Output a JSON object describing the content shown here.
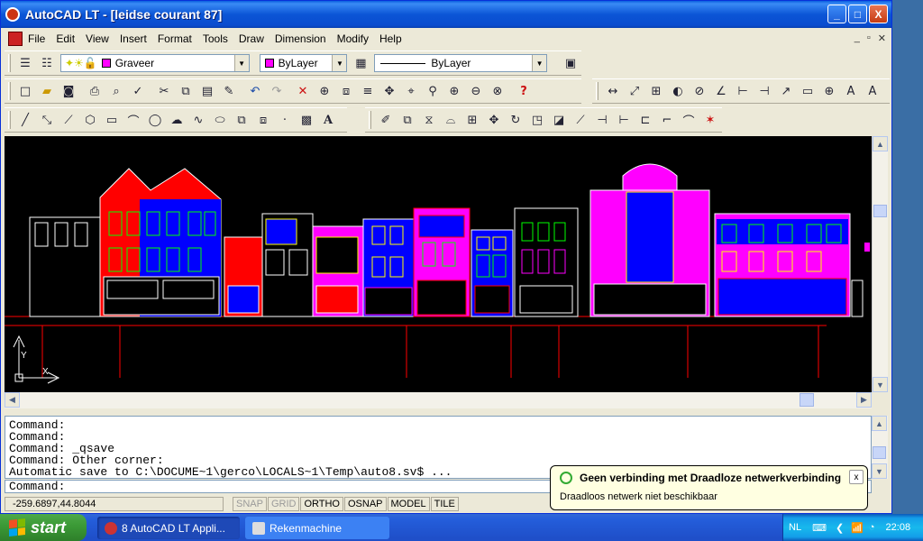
{
  "window": {
    "title": "AutoCAD LT - [leidse courant 87]",
    "minimize": "_",
    "maximize": "□",
    "close": "X"
  },
  "menu": {
    "items": [
      "File",
      "Edit",
      "View",
      "Insert",
      "Format",
      "Tools",
      "Draw",
      "Dimension",
      "Modify",
      "Help"
    ],
    "doc_controls": [
      "_",
      "▫",
      "✕"
    ]
  },
  "layer_toolbar": {
    "layer_name": "Graveer",
    "color_value": "ByLayer",
    "linetype_value": "ByLayer",
    "layer_color": "#ff00ff"
  },
  "drawing": {
    "background": "#000000",
    "accent_red": "#ff0000",
    "accent_magenta": "#ff00ff",
    "accent_blue": "#0000ff",
    "accent_yellow": "#ffff00",
    "accent_green": "#00ff00",
    "ucs_y_label": "Y",
    "ucs_x_label": "X"
  },
  "command": {
    "history": [
      "Command:",
      "Command:",
      "Command: _qsave",
      "Command: Other corner:",
      "Automatic save to C:\\DOCUME~1\\gerco\\LOCALS~1\\Temp\\auto8.sv$ ..."
    ],
    "prompt": "Command:"
  },
  "status": {
    "coords": "-259.6897,44.8044",
    "toggles": [
      {
        "label": "SNAP",
        "on": false
      },
      {
        "label": "GRID",
        "on": false
      },
      {
        "label": "ORTHO",
        "on": true
      },
      {
        "label": "OSNAP",
        "on": true
      },
      {
        "label": "MODEL",
        "on": true
      },
      {
        "label": "TILE",
        "on": true
      }
    ]
  },
  "balloon": {
    "title": "Geen verbinding met Draadloze netwerkverbinding",
    "text": "Draadloos netwerk niet beschikbaar",
    "close": "x"
  },
  "taskbar": {
    "start_label": "start",
    "tasks": [
      {
        "label": "8 AutoCAD LT Appli...",
        "active": true
      },
      {
        "label": "Rekenmachine",
        "active": false
      }
    ],
    "language": "NL",
    "clock": "22:08"
  }
}
